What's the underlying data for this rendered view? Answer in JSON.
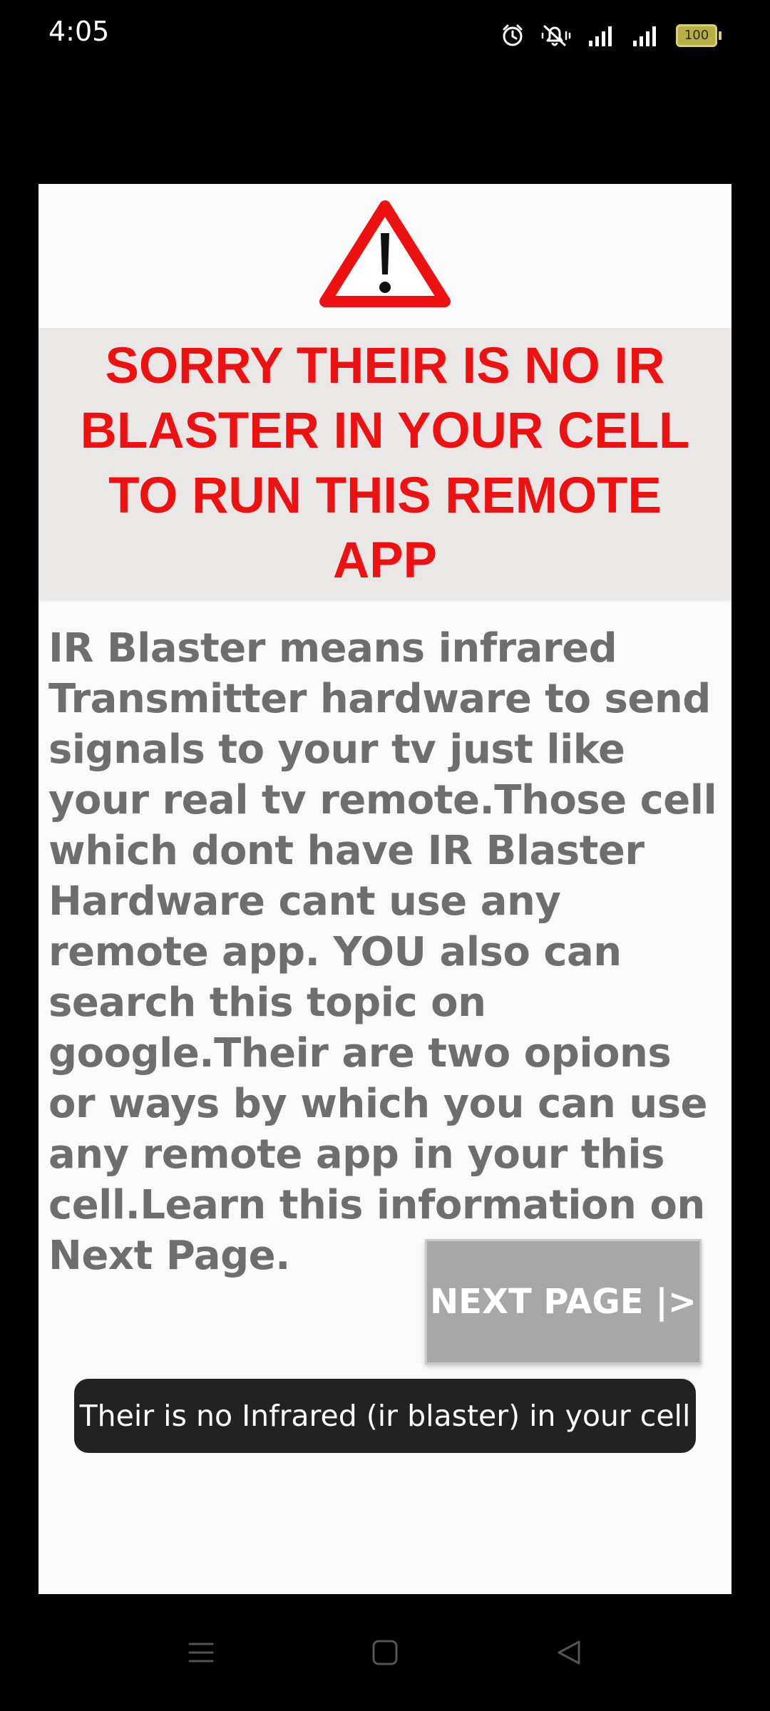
{
  "status_bar": {
    "time": "4:05",
    "battery": "100",
    "icons": [
      "alarm-icon",
      "bell-muted-icon",
      "signal-icon",
      "signal-icon",
      "battery-icon"
    ]
  },
  "dialog": {
    "icon": "warning-triangle-icon",
    "title": "SORRY THEIR IS NO IR BLASTER IN YOUR CELL TO RUN THIS REMOTE APP",
    "body": "IR Blaster means infrared Transmitter hardware to send signals to your tv just like your real tv remote.Those cell which dont have IR Blaster Hardware cant use any remote app. YOU also can search this topic on google.Their are two opions or ways by which you can use any remote app in your this cell.Learn this information on Next Page.",
    "next_button_label": "NEXT PAGE |>"
  },
  "toast": {
    "message": "Their is no Infrared (ir blaster) in your cell"
  },
  "nav_bar": {
    "icons": [
      "menu-icon",
      "home-icon",
      "back-icon"
    ]
  },
  "colors": {
    "title_red": "#ee1111",
    "body_gray": "#6e6e6e",
    "button_gray": "#a7a7a7",
    "toast_bg": "#222222"
  }
}
